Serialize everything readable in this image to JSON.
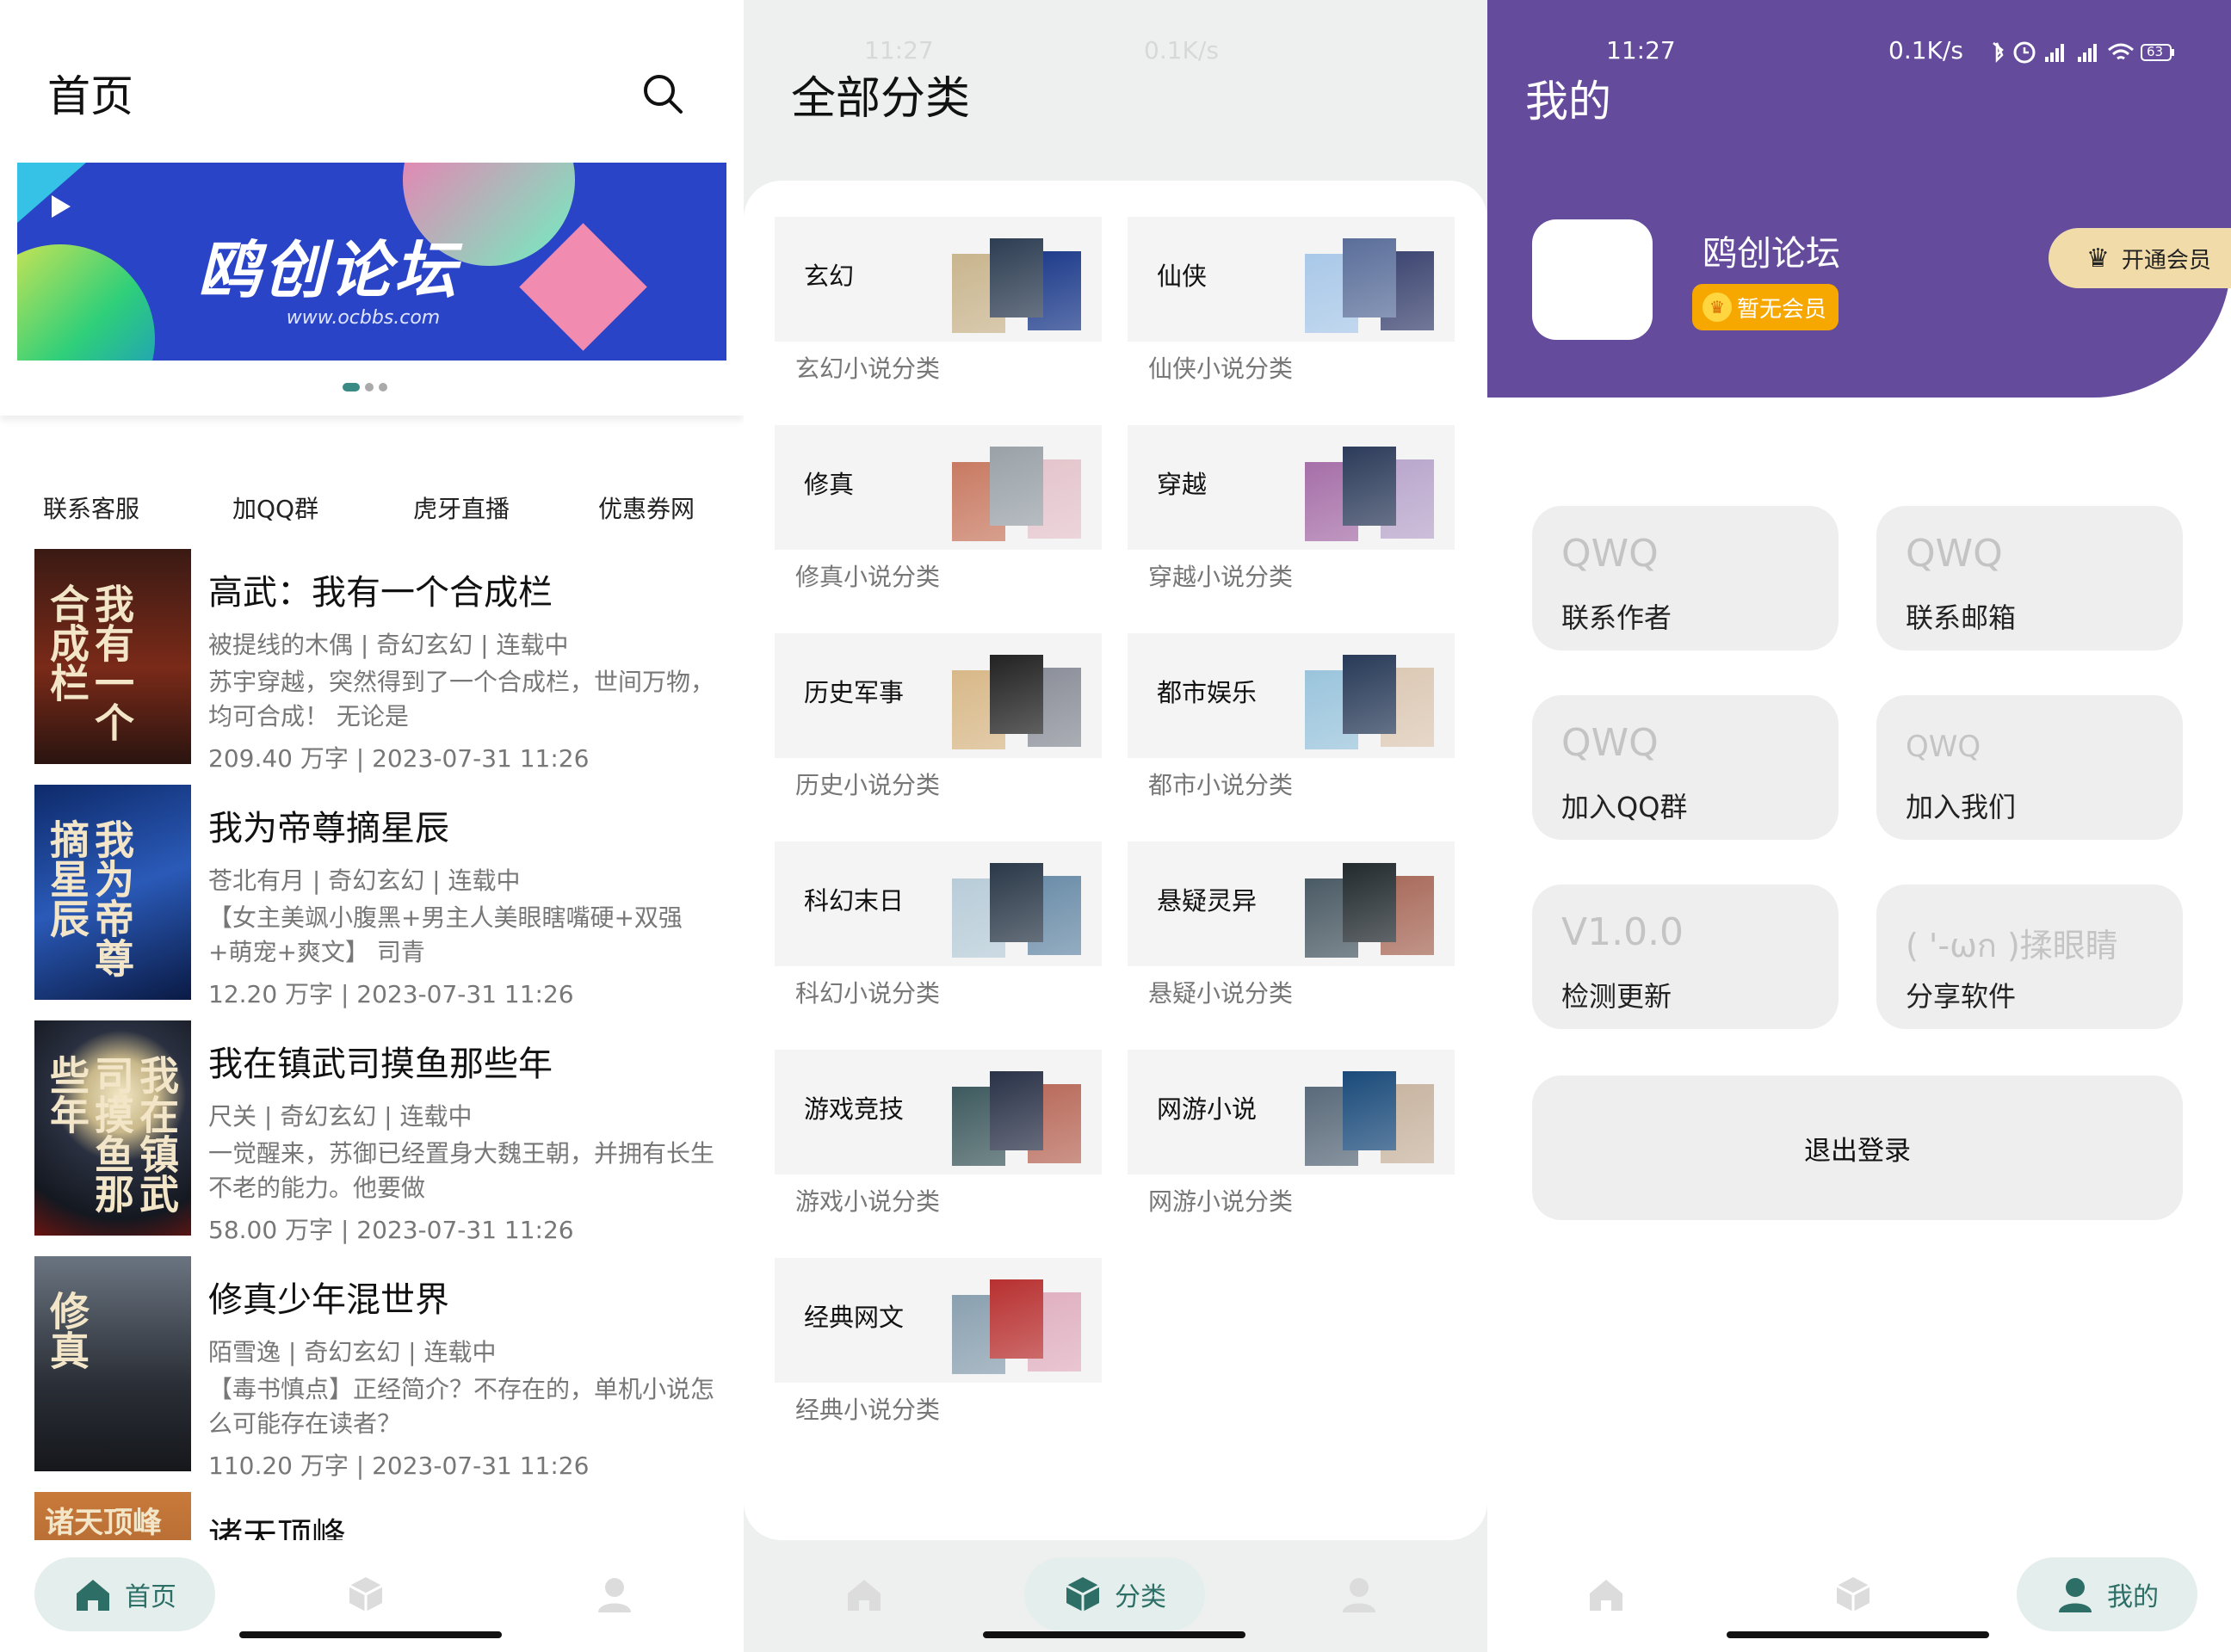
{
  "home": {
    "title": "首页",
    "banner": {
      "title": "鸥创论坛",
      "url": "www.ocbbs.com"
    },
    "links": [
      "联系客服",
      "加QQ群",
      "虎牙直播",
      "优惠券网"
    ],
    "books": [
      {
        "title": "高武：我有一个合成栏",
        "meta": "被提线的木偶 | 奇幻玄幻 | 连载中",
        "desc": "苏宇穿越，突然得到了一个合成栏，世间万物，均可合成！ 无论是",
        "size": "209.40 万字 | 2023-07-31 11:26",
        "cover_text": "我有一个合成栏",
        "cover_color": "#5a1a12"
      },
      {
        "title": "我为帝尊摘星辰",
        "meta": "苍北有月 | 奇幻玄幻 | 连载中",
        "desc": "【女主美飒小腹黑+男主人美眼瞎嘴硬+双强+萌宠+爽文】 司青",
        "size": "12.20 万字 | 2023-07-31 11:26",
        "cover_text": "我为帝尊摘星辰",
        "cover_color": "#1c3c8a"
      },
      {
        "title": "我在镇武司摸鱼那些年",
        "meta": "尺关 | 奇幻玄幻 | 连载中",
        "desc": "一觉醒来，苏御已经置身大魏王朝，并拥有长生不老的能力。他要做",
        "size": "58.00 万字 | 2023-07-31 11:26",
        "cover_text": "我在镇武司摸鱼那些年",
        "cover_color": "#2a2f3e"
      },
      {
        "title": "修真少年混世界",
        "meta": "陌雪逸 | 奇幻玄幻 | 连载中",
        "desc": "【毒书慎点】正经简介？不存在的，单机小说怎么可能存在读者？",
        "size": "110.20 万字 | 2023-07-31 11:26",
        "cover_text": "修真",
        "cover_color": "#3a3f48"
      },
      {
        "title": "诸天顶峰",
        "meta": "",
        "desc": "",
        "size": "",
        "cover_text": "诸天顶峰",
        "cover_color": "#8a4a22"
      }
    ]
  },
  "category": {
    "title": "全部分类",
    "status_time": "11:27",
    "status_speed": "0.1K/s",
    "items": [
      {
        "name": "玄幻",
        "sub": "玄幻小说分类",
        "c": [
          "#c9b58e",
          "#2d3d52",
          "#1c3a8a"
        ]
      },
      {
        "name": "仙侠",
        "sub": "仙侠小说分类",
        "c": [
          "#a9c8e8",
          "#5a6e9a",
          "#3b4470"
        ]
      },
      {
        "name": "修真",
        "sub": "修真小说分类",
        "c": [
          "#c87a62",
          "#9aa2a8",
          "#e4c4cc"
        ]
      },
      {
        "name": "穿越",
        "sub": "穿越小说分类",
        "c": [
          "#a66fa8",
          "#2c3b5a",
          "#b9a6cc"
        ]
      },
      {
        "name": "历史军事",
        "sub": "历史小说分类",
        "c": [
          "#d8b888",
          "#222222",
          "#8a8e98"
        ]
      },
      {
        "name": "都市娱乐",
        "sub": "都市小说分类",
        "c": [
          "#9ac4dc",
          "#283a58",
          "#dcc8b4"
        ]
      },
      {
        "name": "科幻末日",
        "sub": "科幻小说分类",
        "c": [
          "#b8ccd8",
          "#2a3848",
          "#6a8ca8"
        ]
      },
      {
        "name": "悬疑灵异",
        "sub": "悬疑小说分类",
        "c": [
          "#4a5a64",
          "#222a2e",
          "#a86a5a"
        ]
      },
      {
        "name": "游戏竞技",
        "sub": "游戏小说分类",
        "c": [
          "#3e5a5e",
          "#2a3248",
          "#b86a5a"
        ]
      },
      {
        "name": "网游小说",
        "sub": "网游小说分类",
        "c": [
          "#5a6a7a",
          "#1a4a7a",
          "#c8b4a0"
        ]
      },
      {
        "name": "经典网文",
        "sub": "经典小说分类",
        "c": [
          "#8aa0b0",
          "#b83030",
          "#e0b0c0"
        ]
      }
    ]
  },
  "mine": {
    "title": "我的",
    "status_time": "11:27",
    "status_speed": "0.1K/s",
    "status_battery": "63",
    "username": "鸥创论坛",
    "vip_badge": "暂无会员",
    "vip_button": "开通会员",
    "tiles": [
      {
        "big": "QWQ",
        "label": "联系作者"
      },
      {
        "big": "QWQ",
        "label": "联系邮箱"
      },
      {
        "big": "QWQ",
        "label": "加入QQ群"
      },
      {
        "big": "QWQ",
        "label": "加入我们"
      },
      {
        "big": "V1.0.0",
        "label": "检测更新"
      },
      {
        "big": "( '-ωก )揉眼睛",
        "label": "分享软件"
      }
    ],
    "logout": "退出登录"
  },
  "nav": {
    "home": "首页",
    "category": "分类",
    "mine": "我的"
  },
  "colors": {
    "accent": "#2d6f66",
    "purple": "#654b9c",
    "vip_gold": "#f6a800"
  }
}
